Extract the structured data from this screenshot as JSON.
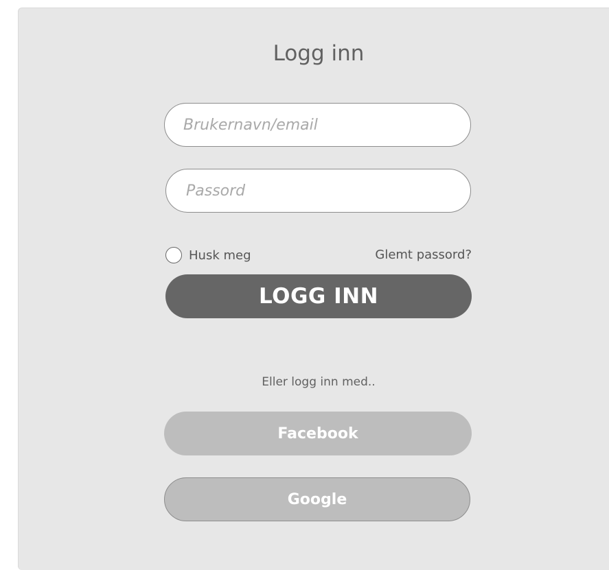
{
  "login": {
    "title": "Logg inn",
    "username_placeholder": "Brukernavn/email",
    "password_placeholder": "Passord",
    "remember_label": "Husk meg",
    "forgot_label": "Glemt passord?",
    "submit_label": "LOGG INN",
    "alt_text": "Eller logg inn med..",
    "facebook_label": "Facebook",
    "google_label": "Google"
  },
  "colors": {
    "panel_background": "#e7e7e7",
    "primary_button": "#666666",
    "social_button": "#bdbdbd"
  }
}
